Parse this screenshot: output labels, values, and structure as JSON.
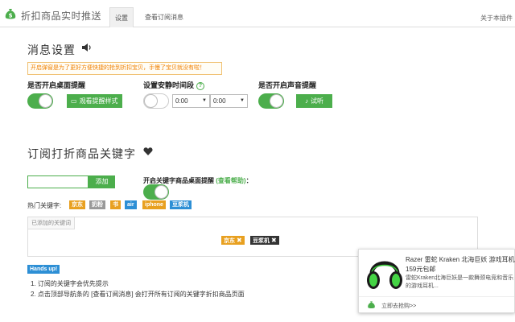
{
  "header": {
    "title": "折扣商品实时推送",
    "tabs": [
      "设置",
      "查看订阅消息"
    ],
    "about": "关于本插件"
  },
  "notify": {
    "heading": "消息设置",
    "notice": "开启弹窗是为了更好方便快捷的抢到折扣宝贝，手慢了宝贝就没有啦！",
    "desktop_label": "是否开启桌面提醒",
    "desktop_on": true,
    "view_style_button": "观看提醒样式",
    "quiet_label": "设置安静时间段",
    "quiet_help": "?",
    "quiet_start": "0:00",
    "quiet_end": "0:00",
    "quiet_on": false,
    "sound_label": "是否开启声音提醒",
    "sound_on": true,
    "listen_button": "试听"
  },
  "keywords": {
    "heading": "订阅打折商品关键字",
    "input_value": "",
    "add_button": "添加",
    "keyword_desktop_label": "开启关键字商品桌面提醒",
    "help_link": "(查看帮助)",
    "colon": "：",
    "keyword_desktop_on": true,
    "hot_label": "热门关键字:",
    "hot_tags": [
      {
        "text": "京东",
        "color": "#e8a020"
      },
      {
        "text": "奶粉",
        "color": "#999999"
      },
      {
        "text": "书",
        "color": "#e8a020"
      },
      {
        "text": "air",
        "color": "#2d8fd5"
      },
      {
        "text": "iphone",
        "color": "#e8a020"
      },
      {
        "text": "豆浆机",
        "color": "#2d8fd5"
      }
    ],
    "added_title": "已添加的关键词",
    "added": [
      {
        "text": "京东",
        "color": "#e8a020"
      },
      {
        "text": "豆浆机",
        "color": "#333333"
      }
    ]
  },
  "tips": {
    "badge": "Hands up!",
    "items": [
      "1. 订阅的关键字会优先提示",
      "2. 点击顶部导航条的 [查看订阅消息] 会打开所有订阅的关键字折扣商品页面"
    ]
  },
  "popup": {
    "title": "Razer 雷蛇 Kraken 北海巨妖 游戏耳机",
    "price": "159元包邮",
    "desc": "雷蛇Kraken北海巨妖是一款舞颈电竞和音乐的游戏耳机...",
    "buy_link": "立即去抢购>>"
  },
  "colors": {
    "accent": "#4cae4c",
    "warning": "#f08000",
    "info": "#2d8fd5"
  }
}
